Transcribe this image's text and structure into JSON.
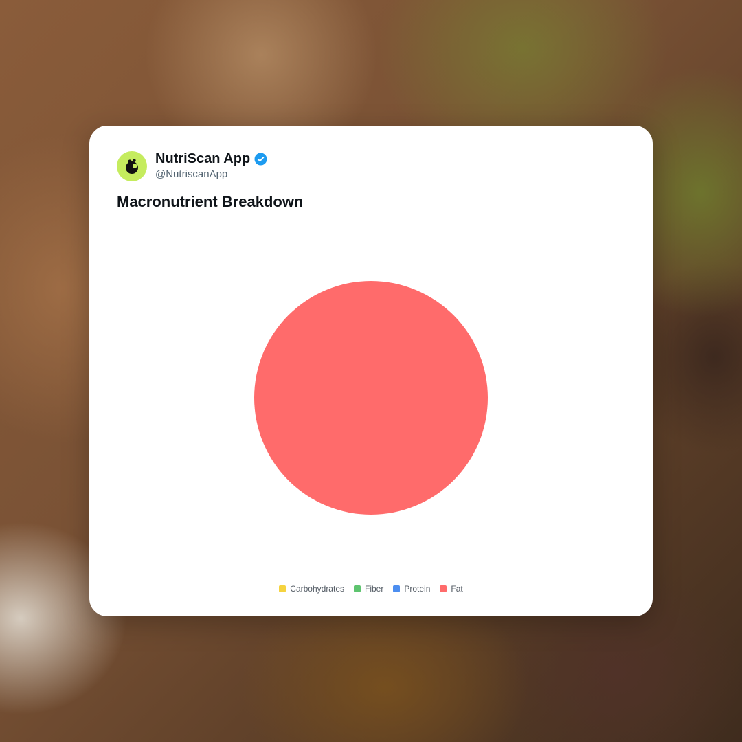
{
  "account": {
    "display_name": "NutriScan App",
    "handle": "@NutriscanApp",
    "avatar_icon": "nutriscan-logo-icon",
    "verified_icon": "verified-badge-icon",
    "avatar_color": "#c5ec5e",
    "verified_color": "#1d9bf0"
  },
  "chart_data": {
    "type": "pie",
    "title": "Macronutrient Breakdown",
    "categories": [
      "Carbohydrates",
      "Fiber",
      "Protein",
      "Fat"
    ],
    "values": [
      0,
      0,
      0,
      100
    ],
    "colors": [
      "#f5d33f",
      "#5ec46f",
      "#4c8ef0",
      "#ff6b6b"
    ],
    "legend_position": "bottom"
  }
}
